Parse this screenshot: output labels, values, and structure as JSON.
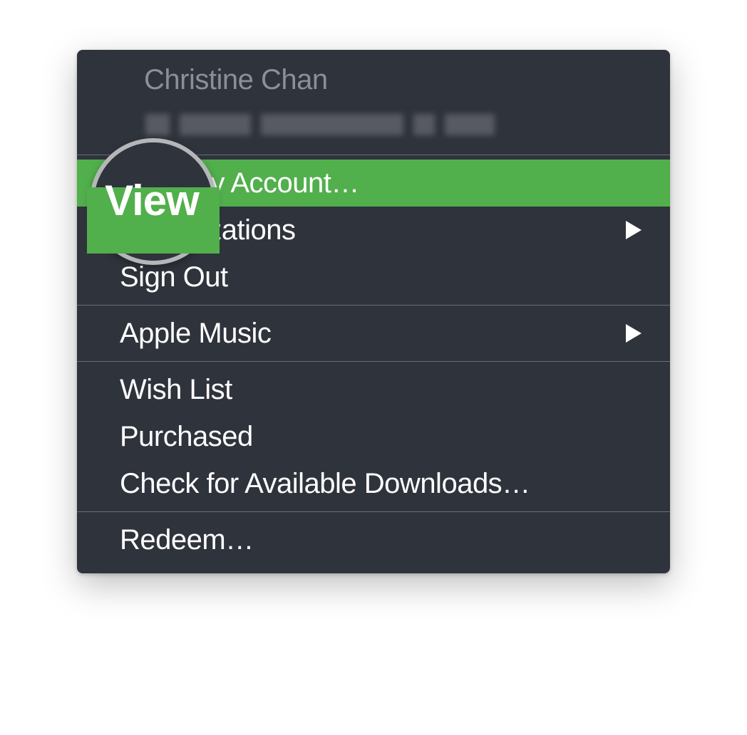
{
  "account": {
    "name": "Christine Chan"
  },
  "menu": {
    "view_my_account": "View My Account…",
    "authorizations": "Authorizations",
    "sign_out": "Sign Out",
    "apple_music": "Apple Music",
    "wish_list": "Wish List",
    "purchased": "Purchased",
    "check_downloads": "Check for Available Downloads…",
    "redeem": "Redeem…"
  },
  "annotation": {
    "magnified_text": "View"
  },
  "colors": {
    "menu_bg": "#2f333c",
    "highlight": "#51af4c",
    "separator": "#6a6d74",
    "text": "#ffffff",
    "muted_text": "#8c8f94",
    "annotation_ring": "#b5b6b9"
  }
}
